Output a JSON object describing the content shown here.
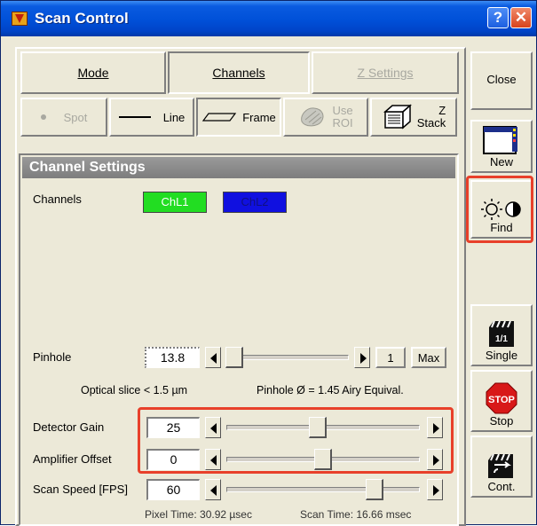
{
  "window": {
    "title": "Scan Control",
    "help_label": "?",
    "close_label": "✕"
  },
  "tabs": [
    {
      "label": "Mode",
      "state": "normal"
    },
    {
      "label": "Channels",
      "state": "active"
    },
    {
      "label": "Z Settings",
      "state": "disabled"
    }
  ],
  "mode_buttons": {
    "spot": "Spot",
    "line": "Line",
    "frame": "Frame",
    "use_roi_line1": "Use",
    "use_roi_line2": "ROI",
    "zstack_line1": "Z",
    "zstack_line2": "Stack"
  },
  "section": {
    "title": "Channel Settings"
  },
  "channels": {
    "label": "Channels",
    "items": [
      {
        "label": "ChL1",
        "color": "#22dd22"
      },
      {
        "label": "ChL2",
        "color": "#1010e0"
      }
    ]
  },
  "pinhole": {
    "label": "Pinhole",
    "value": "13.8",
    "step_label": "1",
    "max_label": "Max",
    "slider_level": 0.02,
    "optical_slice": "Optical slice < 1.5 µm",
    "diameter": "Pinhole Ø = 1.45 Airy Equival."
  },
  "detector_gain": {
    "label": "Detector Gain",
    "value": "25",
    "slider_level": 0.47
  },
  "amplifier_offset": {
    "label": "Amplifier Offset",
    "value": "0",
    "slider_level": 0.5
  },
  "scan_speed": {
    "label": "Scan Speed [FPS]",
    "value": "60",
    "slider_level": 0.78
  },
  "timing": {
    "pixel_time": "Pixel Time:  30.92 µsec",
    "scan_time": "Scan Time:  16.66 msec"
  },
  "side_buttons": {
    "close": "Close",
    "new": "New",
    "find": "Find",
    "single": "Single",
    "stop": "Stop",
    "stop_icon_text": "STOP",
    "single_icon_text": "1/1",
    "cont": "Cont."
  },
  "colors": {
    "highlight": "#e8402a",
    "title_bar": "#0050d8"
  }
}
